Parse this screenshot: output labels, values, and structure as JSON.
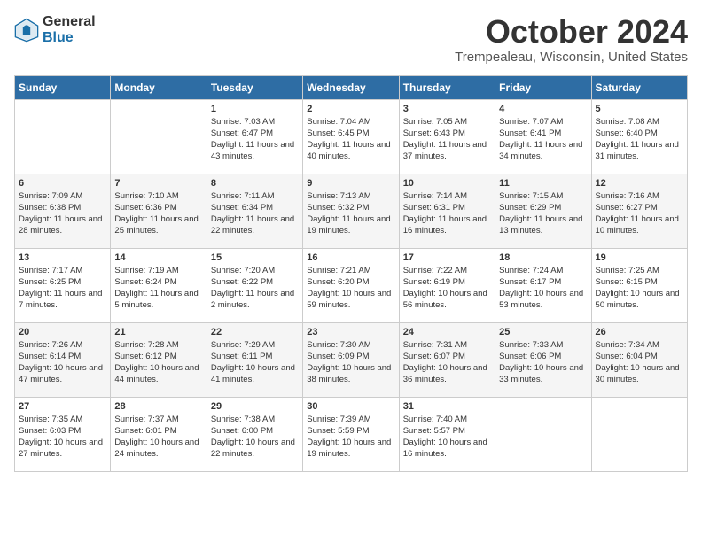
{
  "logo": {
    "general": "General",
    "blue": "Blue"
  },
  "title": "October 2024",
  "location": "Trempealeau, Wisconsin, United States",
  "days_of_week": [
    "Sunday",
    "Monday",
    "Tuesday",
    "Wednesday",
    "Thursday",
    "Friday",
    "Saturday"
  ],
  "weeks": [
    [
      {
        "day": "",
        "info": ""
      },
      {
        "day": "",
        "info": ""
      },
      {
        "day": "1",
        "info": "Sunrise: 7:03 AM\nSunset: 6:47 PM\nDaylight: 11 hours and 43 minutes."
      },
      {
        "day": "2",
        "info": "Sunrise: 7:04 AM\nSunset: 6:45 PM\nDaylight: 11 hours and 40 minutes."
      },
      {
        "day": "3",
        "info": "Sunrise: 7:05 AM\nSunset: 6:43 PM\nDaylight: 11 hours and 37 minutes."
      },
      {
        "day": "4",
        "info": "Sunrise: 7:07 AM\nSunset: 6:41 PM\nDaylight: 11 hours and 34 minutes."
      },
      {
        "day": "5",
        "info": "Sunrise: 7:08 AM\nSunset: 6:40 PM\nDaylight: 11 hours and 31 minutes."
      }
    ],
    [
      {
        "day": "6",
        "info": "Sunrise: 7:09 AM\nSunset: 6:38 PM\nDaylight: 11 hours and 28 minutes."
      },
      {
        "day": "7",
        "info": "Sunrise: 7:10 AM\nSunset: 6:36 PM\nDaylight: 11 hours and 25 minutes."
      },
      {
        "day": "8",
        "info": "Sunrise: 7:11 AM\nSunset: 6:34 PM\nDaylight: 11 hours and 22 minutes."
      },
      {
        "day": "9",
        "info": "Sunrise: 7:13 AM\nSunset: 6:32 PM\nDaylight: 11 hours and 19 minutes."
      },
      {
        "day": "10",
        "info": "Sunrise: 7:14 AM\nSunset: 6:31 PM\nDaylight: 11 hours and 16 minutes."
      },
      {
        "day": "11",
        "info": "Sunrise: 7:15 AM\nSunset: 6:29 PM\nDaylight: 11 hours and 13 minutes."
      },
      {
        "day": "12",
        "info": "Sunrise: 7:16 AM\nSunset: 6:27 PM\nDaylight: 11 hours and 10 minutes."
      }
    ],
    [
      {
        "day": "13",
        "info": "Sunrise: 7:17 AM\nSunset: 6:25 PM\nDaylight: 11 hours and 7 minutes."
      },
      {
        "day": "14",
        "info": "Sunrise: 7:19 AM\nSunset: 6:24 PM\nDaylight: 11 hours and 5 minutes."
      },
      {
        "day": "15",
        "info": "Sunrise: 7:20 AM\nSunset: 6:22 PM\nDaylight: 11 hours and 2 minutes."
      },
      {
        "day": "16",
        "info": "Sunrise: 7:21 AM\nSunset: 6:20 PM\nDaylight: 10 hours and 59 minutes."
      },
      {
        "day": "17",
        "info": "Sunrise: 7:22 AM\nSunset: 6:19 PM\nDaylight: 10 hours and 56 minutes."
      },
      {
        "day": "18",
        "info": "Sunrise: 7:24 AM\nSunset: 6:17 PM\nDaylight: 10 hours and 53 minutes."
      },
      {
        "day": "19",
        "info": "Sunrise: 7:25 AM\nSunset: 6:15 PM\nDaylight: 10 hours and 50 minutes."
      }
    ],
    [
      {
        "day": "20",
        "info": "Sunrise: 7:26 AM\nSunset: 6:14 PM\nDaylight: 10 hours and 47 minutes."
      },
      {
        "day": "21",
        "info": "Sunrise: 7:28 AM\nSunset: 6:12 PM\nDaylight: 10 hours and 44 minutes."
      },
      {
        "day": "22",
        "info": "Sunrise: 7:29 AM\nSunset: 6:11 PM\nDaylight: 10 hours and 41 minutes."
      },
      {
        "day": "23",
        "info": "Sunrise: 7:30 AM\nSunset: 6:09 PM\nDaylight: 10 hours and 38 minutes."
      },
      {
        "day": "24",
        "info": "Sunrise: 7:31 AM\nSunset: 6:07 PM\nDaylight: 10 hours and 36 minutes."
      },
      {
        "day": "25",
        "info": "Sunrise: 7:33 AM\nSunset: 6:06 PM\nDaylight: 10 hours and 33 minutes."
      },
      {
        "day": "26",
        "info": "Sunrise: 7:34 AM\nSunset: 6:04 PM\nDaylight: 10 hours and 30 minutes."
      }
    ],
    [
      {
        "day": "27",
        "info": "Sunrise: 7:35 AM\nSunset: 6:03 PM\nDaylight: 10 hours and 27 minutes."
      },
      {
        "day": "28",
        "info": "Sunrise: 7:37 AM\nSunset: 6:01 PM\nDaylight: 10 hours and 24 minutes."
      },
      {
        "day": "29",
        "info": "Sunrise: 7:38 AM\nSunset: 6:00 PM\nDaylight: 10 hours and 22 minutes."
      },
      {
        "day": "30",
        "info": "Sunrise: 7:39 AM\nSunset: 5:59 PM\nDaylight: 10 hours and 19 minutes."
      },
      {
        "day": "31",
        "info": "Sunrise: 7:40 AM\nSunset: 5:57 PM\nDaylight: 10 hours and 16 minutes."
      },
      {
        "day": "",
        "info": ""
      },
      {
        "day": "",
        "info": ""
      }
    ]
  ]
}
